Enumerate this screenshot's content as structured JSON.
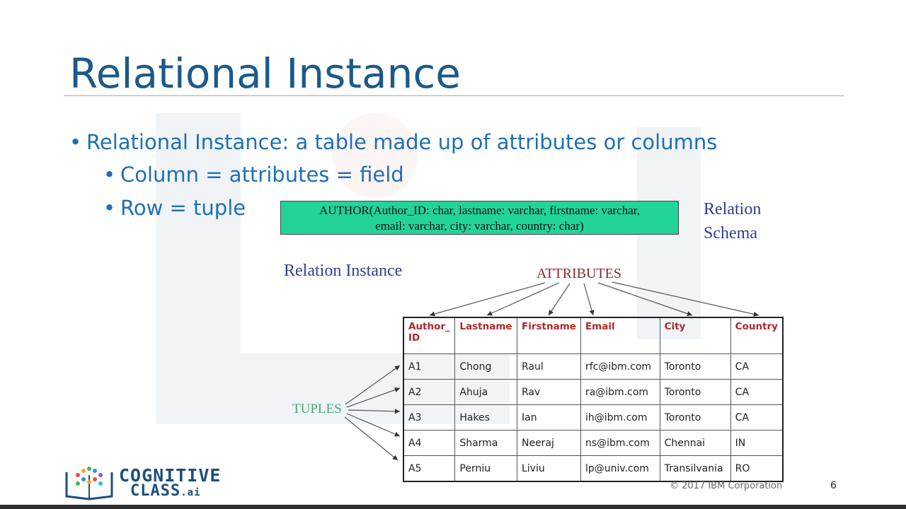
{
  "slide": {
    "title": "Relational Instance",
    "bullets": [
      "Relational Instance: a table made up of attributes or columns",
      "Column = attributes = field",
      "Row = tuple"
    ]
  },
  "diagram": {
    "schema_line1": "AUTHOR(Author_ID: char, lastname: varchar, firstname: varchar,",
    "schema_line2": "email: varchar, city: varchar, country: char)",
    "relation_schema_line1": "Relation",
    "relation_schema_line2": "Schema",
    "relation_instance_label": "Relation Instance",
    "attributes_label": "ATTRIBUTES",
    "tuples_label": "TUPLES"
  },
  "table": {
    "headers": [
      "Author_ ID",
      "Lastname",
      "Firstname",
      "Email",
      "City",
      "Country"
    ],
    "rows": [
      [
        "A1",
        "Chong",
        "Raul",
        "rfc@ibm.com",
        "Toronto",
        "CA"
      ],
      [
        "A2",
        "Ahuja",
        "Rav",
        "ra@ibm.com",
        "Toronto",
        "CA"
      ],
      [
        "A3",
        "Hakes",
        "Ian",
        "ih@ibm.com",
        "Toronto",
        "CA"
      ],
      [
        "A4",
        "Sharma",
        "Neeraj",
        "ns@ibm.com",
        "Chennai",
        "IN"
      ],
      [
        "A5",
        "Perniu",
        "Liviu",
        "lp@univ.com",
        "Transilvania",
        "RO"
      ]
    ]
  },
  "logo": {
    "line1": "COGNITIVE",
    "line2": "CLASS",
    "suffix": ".ai"
  },
  "footer": {
    "copyright": "© 2017 IBM Corporation",
    "page": "6"
  },
  "colors": {
    "title": "#1b5a8a",
    "bullet": "#1e6fb8",
    "schema_box": "#22d39a",
    "header_text": "#b0282e",
    "serif_label": "#2e3f93",
    "attributes_label": "#8a2a2a",
    "tuples_label": "#49a879"
  }
}
